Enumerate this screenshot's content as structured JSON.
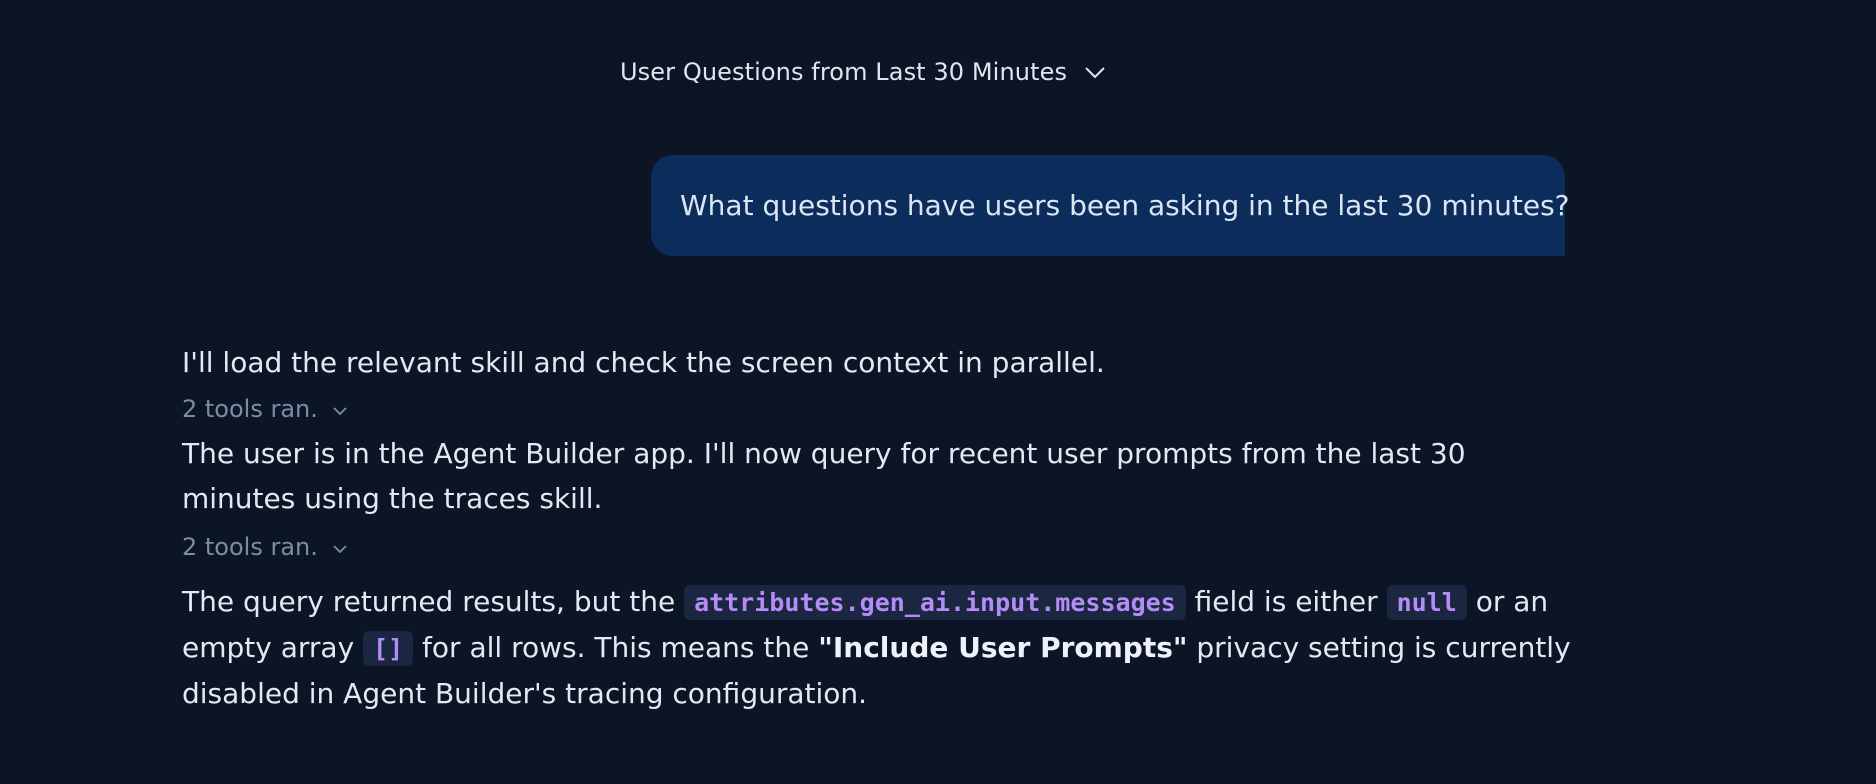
{
  "header": {
    "title": "User Questions from Last 30 Minutes",
    "dropdown_icon": "chevron-down-icon"
  },
  "user_message": {
    "text": "What questions have users been asking in the last 30 minutes?"
  },
  "assistant": {
    "para1": "I'll load the relevant skill and check the screen context in parallel.",
    "tools1": "2 tools ran.",
    "para2": "The user is in the Agent Builder app. I'll now query for recent user prompts from the last 30 minutes using the traces skill.",
    "tools2": "2 tools ran.",
    "para3": {
      "t1": "The query returned results, but the ",
      "code1": "attributes.gen_ai.input.messages",
      "t2": " field is either ",
      "code2": "null",
      "t3": " or an empty array ",
      "code3": "[]",
      "t4": " for all rows. This means the ",
      "bold": "\"Include User Prompts\"",
      "t5": " privacy setting is currently disabled in Agent Builder's tracing configuration."
    }
  },
  "colors": {
    "background": "#0b1526",
    "user_bubble": "#0c2d5c",
    "code_text": "#b48cf7",
    "code_bg": "#1b2740",
    "muted": "#7d8ba3"
  }
}
